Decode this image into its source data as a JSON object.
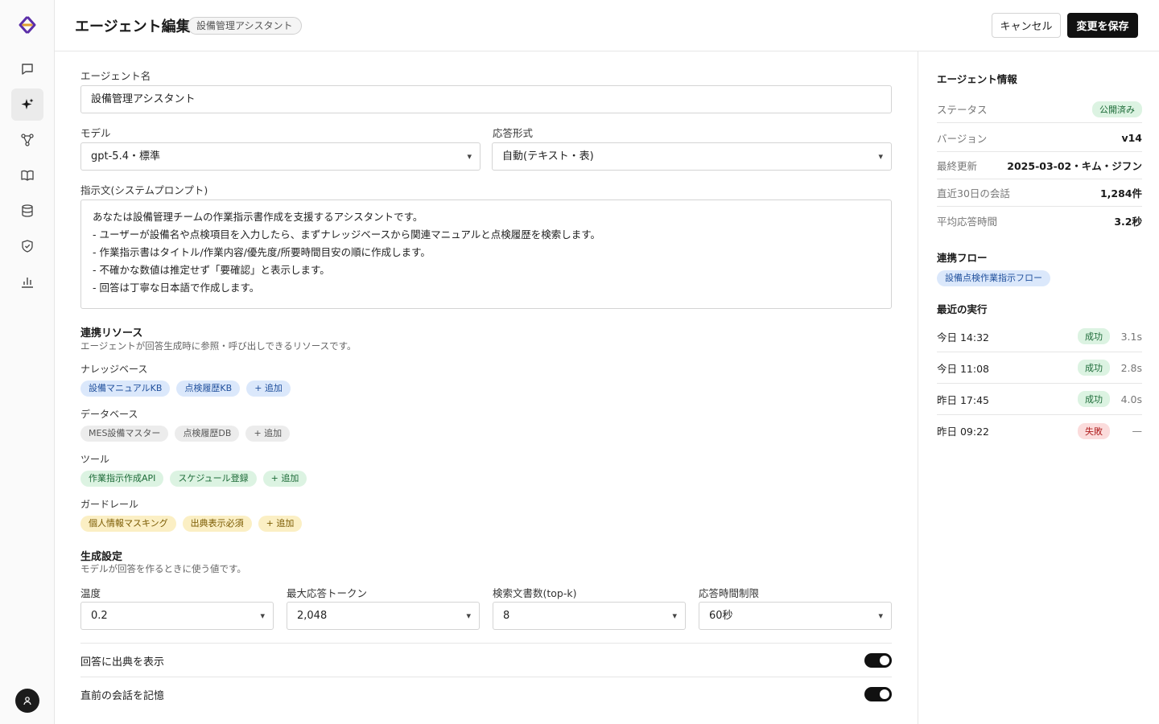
{
  "colors": {
    "accent": "#111111",
    "logo": "#5b2ea8",
    "success": "#1d6b38",
    "failure": "#b02020"
  },
  "rail": {
    "items": [
      {
        "icon": "chat-icon"
      },
      {
        "icon": "sparkle-icon",
        "active": true
      },
      {
        "icon": "flow-icon"
      },
      {
        "icon": "book-icon"
      },
      {
        "icon": "database-icon"
      },
      {
        "icon": "shield-icon"
      },
      {
        "icon": "chart-icon"
      }
    ]
  },
  "header": {
    "title": "エージェント編集",
    "badge": "設備管理アシスタント",
    "cancel_label": "キャンセル",
    "save_label": "変更を保存"
  },
  "form": {
    "name_label": "エージェント名",
    "name_value": "設備管理アシスタント",
    "model_label": "モデル",
    "model_value": "gpt-5.4・標準",
    "format_label": "応答形式",
    "format_value": "自動(テキスト・表)",
    "prompt_label": "指示文(システムプロンプト)",
    "prompt_lines": [
      "あなたは設備管理チームの作業指示書作成を支援するアシスタントです。",
      "- ユーザーが設備名や点検項目を入力したら、まずナレッジベースから関連マニュアルと点検履歴を検索します。",
      "- 作業指示書はタイトル/作業内容/優先度/所要時間目安の順に作成します。",
      "- 不確かな数値は推定せず「要確認」と表示します。",
      "- 回答は丁寧な日本語で作成します。"
    ]
  },
  "resources": {
    "title": "連携リソース",
    "subtitle": "エージェントが回答生成時に参照・呼び出しできるリソースです。",
    "groups": [
      {
        "label": "ナレッジベース",
        "items": [
          "設備マニュアルKB",
          "点検履歴KB"
        ],
        "add": "+ 追加"
      },
      {
        "label": "データベース",
        "items": [
          "MES設備マスター",
          "点検履歴DB"
        ],
        "add": "+ 追加"
      },
      {
        "label": "ツール",
        "items": [
          "作業指示作成API",
          "スケジュール登録"
        ],
        "add": "+ 追加"
      },
      {
        "label": "ガードレール",
        "items": [
          "個人情報マスキング",
          "出典表示必須"
        ],
        "add": "+ 追加"
      }
    ]
  },
  "generation": {
    "title": "生成設定",
    "subtitle": "モデルが回答を作るときに使う値です。",
    "fields": [
      {
        "label": "温度",
        "value": "0.2"
      },
      {
        "label": "最大応答トークン",
        "value": "2,048"
      },
      {
        "label": "検索文書数(top-k)",
        "value": "8"
      },
      {
        "label": "応答時間制限",
        "value": "60秒"
      }
    ],
    "toggles": [
      {
        "label": "回答に出典を表示",
        "on": true
      },
      {
        "label": "直前の会話を記憶",
        "on": true
      }
    ]
  },
  "info": {
    "title": "エージェント情報",
    "rows": [
      {
        "key": "ステータス",
        "value": "公開済み"
      },
      {
        "key": "バージョン",
        "value": "v14"
      },
      {
        "key": "最終更新",
        "value": "2025-03-02・キム・ジフン"
      },
      {
        "key": "直近30日の会話",
        "value": "1,284件"
      },
      {
        "key": "平均応答時間",
        "value": "3.2秒"
      }
    ],
    "flow_title": "連携フロー",
    "flow_chip": "設備点検作業指示フロー",
    "runs_title": "最近の実行",
    "runs": [
      {
        "time": "今日 14:32",
        "status": "成功",
        "duration": "3.1s"
      },
      {
        "time": "今日 11:08",
        "status": "成功",
        "duration": "2.8s"
      },
      {
        "time": "昨日 17:45",
        "status": "成功",
        "duration": "4.0s"
      },
      {
        "time": "昨日 09:22",
        "status": "失敗",
        "duration": "—"
      }
    ]
  }
}
